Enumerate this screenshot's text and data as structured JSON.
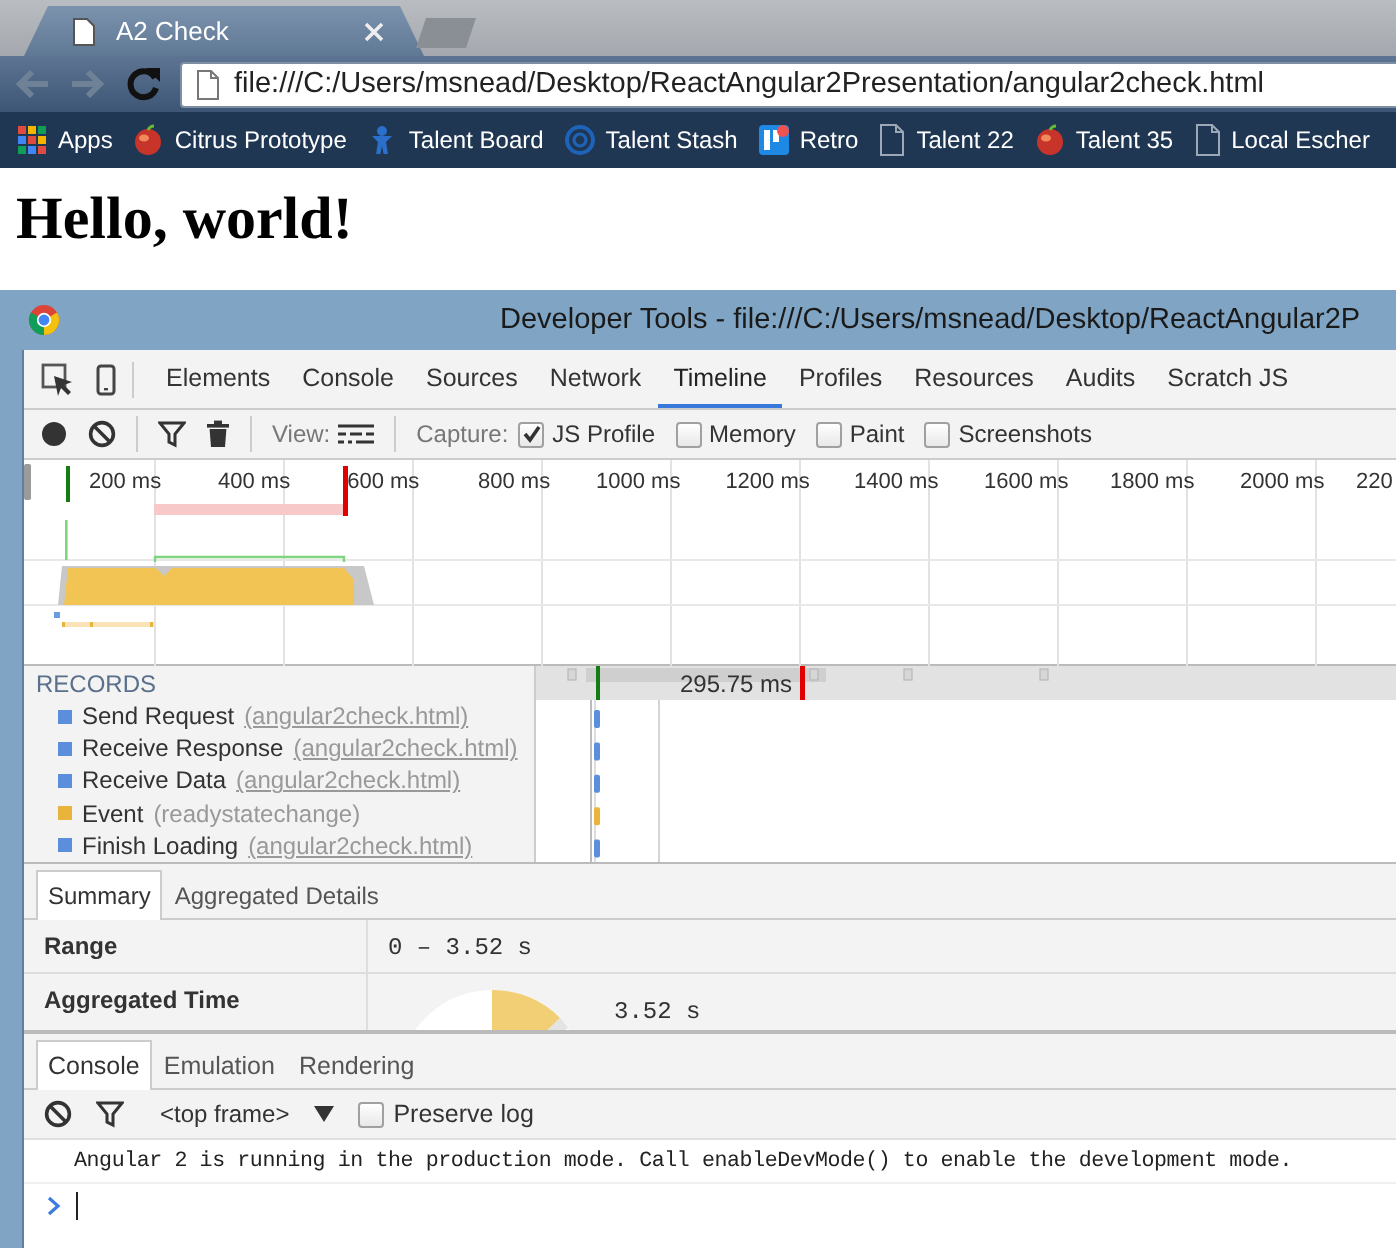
{
  "browser": {
    "tabs": [
      {
        "title": "A2 Check",
        "selected": true
      }
    ],
    "back": {
      "disabled": true
    },
    "forward": {
      "disabled": true
    },
    "address": "file:///C:/Users/msnead/Desktop/ReactAngular2Presentation/angular2check.html"
  },
  "bookmarks": [
    {
      "label": "Apps",
      "kind": "apps"
    },
    {
      "label": "Citrus Prototype",
      "kind": "fruit"
    },
    {
      "label": "Talent Board",
      "kind": "figure"
    },
    {
      "label": "Talent Stash",
      "kind": "ring"
    },
    {
      "label": "Retro",
      "kind": "board"
    },
    {
      "label": "Talent 22",
      "kind": "page"
    },
    {
      "label": "Talent 35",
      "kind": "fruit"
    },
    {
      "label": "Local Escher",
      "kind": "page"
    }
  ],
  "page": {
    "heading": "Hello, world!"
  },
  "devtools": {
    "title": "Developer Tools - file:///C:/Users/msnead/Desktop/ReactAngular2P",
    "panels": [
      {
        "label": "Elements",
        "selected": false
      },
      {
        "label": "Console",
        "selected": false
      },
      {
        "label": "Sources",
        "selected": false
      },
      {
        "label": "Network",
        "selected": false
      },
      {
        "label": "Timeline",
        "selected": true
      },
      {
        "label": "Profiles",
        "selected": false
      },
      {
        "label": "Resources",
        "selected": false
      },
      {
        "label": "Audits",
        "selected": false
      },
      {
        "label": "Scratch JS",
        "selected": false
      }
    ],
    "view_label": "View:",
    "capture_label": "Capture:",
    "capture_options": [
      {
        "label": "JS Profile",
        "checked": true
      },
      {
        "label": "Memory",
        "checked": false
      },
      {
        "label": "Paint",
        "checked": false
      },
      {
        "label": "Screenshots",
        "checked": false
      }
    ],
    "ruler": [
      "200 ms",
      "400 ms",
      "600 ms",
      "800 ms",
      "1000 ms",
      "1200 ms",
      "1400 ms",
      "1600 ms",
      "1800 ms",
      "2000 ms",
      "220"
    ],
    "records_header": "RECORDS",
    "records": [
      {
        "name": "Send Request",
        "detail": "(angular2check.html)",
        "link": true,
        "color": "#5b8fdc"
      },
      {
        "name": "Receive Response",
        "detail": "(angular2check.html)",
        "link": true,
        "color": "#5b8fdc"
      },
      {
        "name": "Receive Data",
        "detail": "(angular2check.html)",
        "link": true,
        "color": "#5b8fdc"
      },
      {
        "name": "Event",
        "detail": "(readystatechange)",
        "link": false,
        "color": "#e8b43c"
      },
      {
        "name": "Finish Loading",
        "detail": "(angular2check.html)",
        "link": true,
        "color": "#5b8fdc"
      }
    ],
    "selection_duration": "295.75 ms",
    "details_tabs": [
      {
        "label": "Summary",
        "selected": true
      },
      {
        "label": "Aggregated Details",
        "selected": false
      }
    ],
    "summary": [
      {
        "label": "Range",
        "value": "0 – 3.52 s",
        "kind": "text"
      },
      {
        "label": "Aggregated Time",
        "value": "3.52 s",
        "kind": "pie"
      }
    ]
  },
  "console": {
    "tabs": [
      {
        "label": "Console",
        "selected": true
      },
      {
        "label": "Emulation",
        "selected": false
      },
      {
        "label": "Rendering",
        "selected": false
      }
    ],
    "context": "<top frame>",
    "preserve_log": {
      "label": "Preserve log",
      "checked": false
    },
    "messages": [
      "Angular 2 is running in the production mode. Call enableDevMode() to enable the development mode."
    ]
  }
}
